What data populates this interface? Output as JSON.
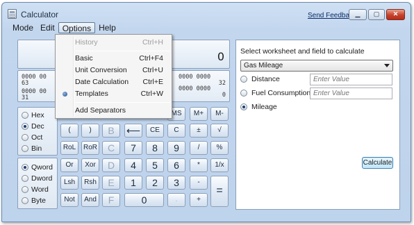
{
  "window": {
    "title": "Calculator",
    "feedback_link": "Send Feedback"
  },
  "menubar": [
    "Mode",
    "Edit",
    "Options",
    "Help"
  ],
  "options_menu": {
    "items": [
      {
        "label": "History",
        "shortcut": "Ctrl+H",
        "disabled": true
      },
      {
        "label": "Basic",
        "shortcut": "Ctrl+F4"
      },
      {
        "label": "Unit Conversion",
        "shortcut": "Ctrl+U"
      },
      {
        "label": "Date Calculation",
        "shortcut": "Ctrl+E"
      },
      {
        "label": "Templates",
        "shortcut": "Ctrl+W",
        "checked": true
      },
      {
        "label": "Add Separators",
        "shortcut": ""
      }
    ]
  },
  "display": {
    "value": "0"
  },
  "bits": {
    "row1_left": "0000  00",
    "row1_num_left": "63",
    "row2_left": "0000  00",
    "row2_num_left": "31",
    "row1_right": "0000  0000",
    "row1_num_right": "32",
    "row2_right": "0000  0000",
    "row2_num_right": "0"
  },
  "base_options": [
    {
      "label": "Hex",
      "selected": false
    },
    {
      "label": "Dec",
      "selected": true
    },
    {
      "label": "Oct",
      "selected": false
    },
    {
      "label": "Bin",
      "selected": false
    }
  ],
  "word_options": [
    {
      "label": "Qword",
      "selected": true
    },
    {
      "label": "Dword",
      "selected": false
    },
    {
      "label": "Word",
      "selected": false
    },
    {
      "label": "Byte",
      "selected": false
    }
  ],
  "keypad": {
    "visible_top_row": [
      "MS",
      "M+",
      "M-"
    ],
    "rows": [
      [
        "(",
        ")",
        "B",
        "⟵",
        "CE",
        "C",
        "±",
        "√"
      ],
      [
        "RoL",
        "RoR",
        "C",
        "7",
        "8",
        "9",
        "/",
        "%"
      ],
      [
        "Or",
        "Xor",
        "D",
        "4",
        "5",
        "6",
        "*",
        "1/x"
      ],
      [
        "Lsh",
        "Rsh",
        "E",
        "1",
        "2",
        "3",
        "-",
        "="
      ],
      [
        "Not",
        "And",
        "F",
        "0",
        ".",
        "+"
      ]
    ]
  },
  "worksheet": {
    "label": "Select worksheet and field to calculate",
    "selected": "Gas Mileage",
    "fields": [
      {
        "label": "Distance",
        "placeholder": "Enter Value",
        "selected": false
      },
      {
        "label": "Fuel Consumption",
        "placeholder": "Enter Value",
        "selected": false
      },
      {
        "label": "Mileage",
        "placeholder": "",
        "selected": true
      }
    ],
    "calculate_label": "Calculate"
  }
}
